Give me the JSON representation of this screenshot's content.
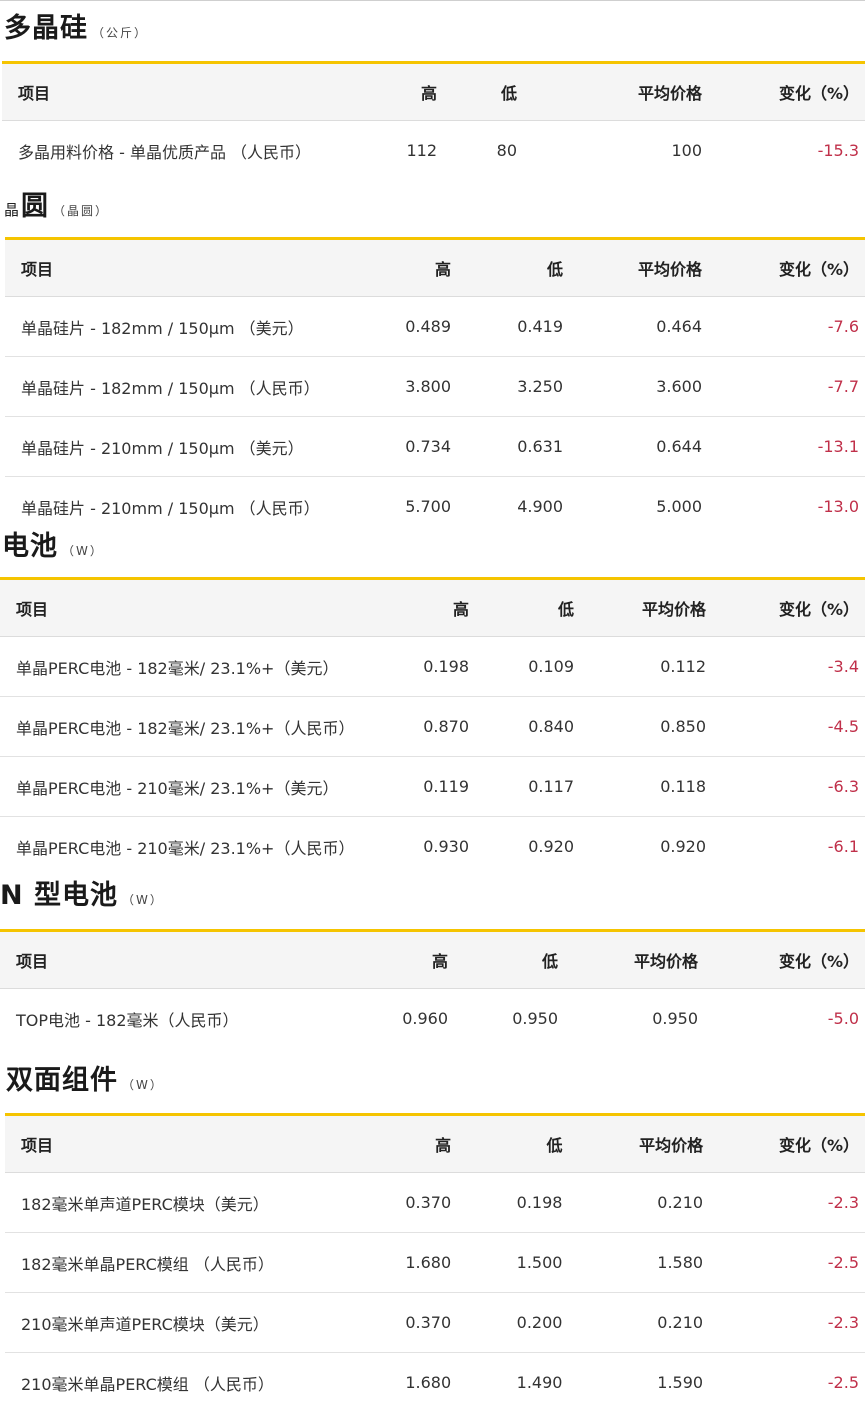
{
  "headers": {
    "item": "项目",
    "high": "高",
    "low": "低",
    "avg": "平均价格",
    "change": "变化（%）"
  },
  "sections": [
    {
      "title": "多晶硅",
      "prefix": "",
      "unit": "（公斤）",
      "rows": [
        {
          "item": "多晶用料价格 - 单晶优质产品 （人民币）",
          "high": "112",
          "low": "80",
          "avg": "100",
          "change": "-15.3"
        }
      ]
    },
    {
      "title": "圆",
      "prefix": "晶",
      "unit": "（晶圆）",
      "rows": [
        {
          "item": "单晶硅片 - 182mm / 150μm （美元）",
          "high": "0.489",
          "low": "0.419",
          "avg": "0.464",
          "change": "-7.6"
        },
        {
          "item": "单晶硅片 - 182mm / 150μm （人民币）",
          "high": "3.800",
          "low": "3.250",
          "avg": "3.600",
          "change": "-7.7"
        },
        {
          "item": "单晶硅片 - 210mm / 150μm （美元）",
          "high": "0.734",
          "low": "0.631",
          "avg": "0.644",
          "change": "-13.1"
        },
        {
          "item": "单晶硅片 - 210mm / 150μm （人民币）",
          "high": "5.700",
          "low": "4.900",
          "avg": "5.000",
          "change": "-13.0"
        }
      ]
    },
    {
      "title": "电池",
      "prefix": "",
      "unit": "（W）",
      "rows": [
        {
          "item": "单晶PERC电池 - 182毫米/ 23.1%+（美元）",
          "high": "0.198",
          "low": "0.109",
          "avg": "0.112",
          "change": "-3.4"
        },
        {
          "item": "单晶PERC电池 - 182毫米/ 23.1%+（人民币）",
          "high": "0.870",
          "low": "0.840",
          "avg": "0.850",
          "change": "-4.5"
        },
        {
          "item": "单晶PERC电池 - 210毫米/ 23.1%+（美元）",
          "high": "0.119",
          "low": "0.117",
          "avg": "0.118",
          "change": "-6.3"
        },
        {
          "item": "单晶PERC电池 - 210毫米/ 23.1%+（人民币）",
          "high": "0.930",
          "low": "0.920",
          "avg": "0.920",
          "change": "-6.1"
        }
      ]
    },
    {
      "title": "N 型电池",
      "prefix": "",
      "unit": "（W）",
      "rows": [
        {
          "item": "TOP电池 - 182毫米（人民币）",
          "high": "0.960",
          "low": "0.950",
          "avg": "0.950",
          "change": "-5.0"
        }
      ]
    },
    {
      "title": "双面组件",
      "prefix": "",
      "unit": "（W）",
      "rows": [
        {
          "item": "182毫米单声道PERC模块（美元）",
          "high": "0.370",
          "low": "0.198",
          "avg": "0.210",
          "change": "-2.3"
        },
        {
          "item": "182毫米单晶PERC模组 （人民币）",
          "high": "1.680",
          "low": "1.500",
          "avg": "1.580",
          "change": "-2.5"
        },
        {
          "item": "210毫米单声道PERC模块（美元）",
          "high": "0.370",
          "low": "0.200",
          "avg": "0.210",
          "change": "-2.3"
        },
        {
          "item": "210毫米单晶PERC模组 （人民币）",
          "high": "1.680",
          "low": "1.490",
          "avg": "1.590",
          "change": "-2.5"
        }
      ]
    }
  ],
  "colors": {
    "accent": "#f5c400",
    "negative": "#c0304a",
    "header_bg": "#f5f5f5"
  }
}
